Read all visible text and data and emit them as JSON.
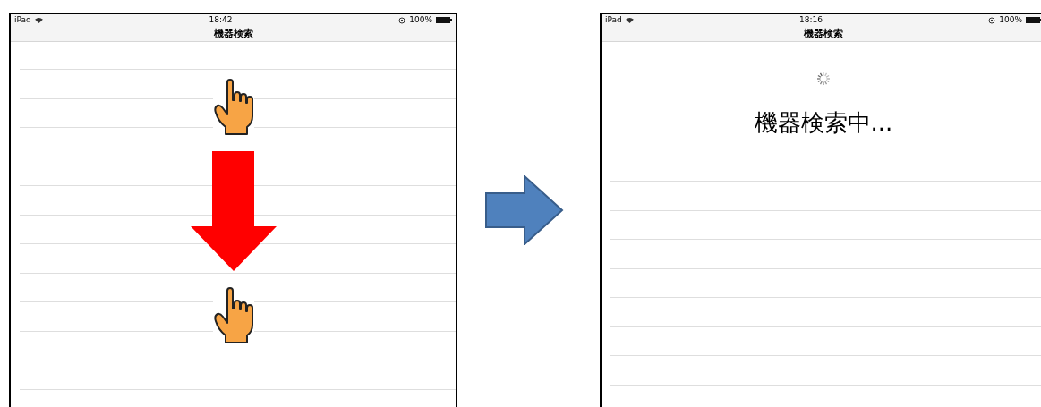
{
  "screens": [
    {
      "kind": "gesture",
      "status_bar": {
        "device": "iPad",
        "time": "18:42",
        "battery": "100%"
      },
      "nav_title": "機器検索"
    },
    {
      "kind": "searching",
      "status_bar": {
        "device": "iPad",
        "time": "18:16",
        "battery": "100%"
      },
      "nav_title": "機器検索",
      "message": "機器検索中..."
    }
  ]
}
